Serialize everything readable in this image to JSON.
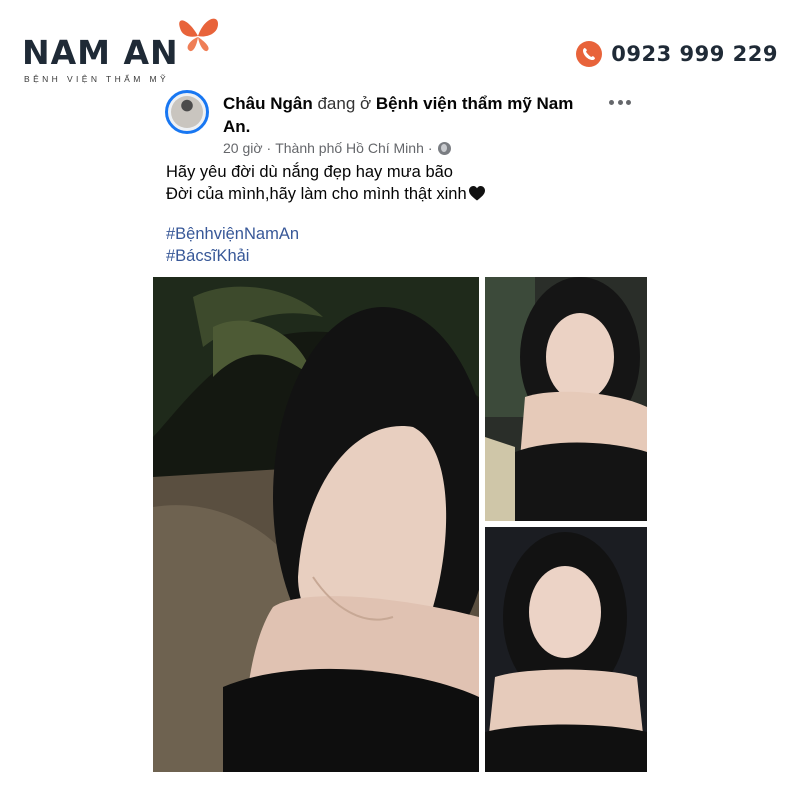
{
  "brand": {
    "name": "NAM AN",
    "subtitle": "BỆNH VIỆN THẨM MỸ",
    "accent_color": "#e8633a",
    "phone": "0923 999 229",
    "phone_icon": "phone-icon",
    "logo_icon": "butterfly-icon"
  },
  "post": {
    "author": "Châu Ngân",
    "checkin_text": "đang ở",
    "location": "Bệnh viện thẩm mỹ Nam An.",
    "time": "20 giờ",
    "separator": "·",
    "place": "Thành phố Hồ Chí Minh",
    "separator2": "·",
    "privacy_icon": "globe-icon",
    "more_icon": "more-options-icon",
    "text_lines": [
      "Hãy yêu đời dù nắng đẹp hay mưa bão",
      "Đời của mình,hãy làm cho mình thật xinh"
    ],
    "emoji": "black-heart",
    "hashtags": [
      "#BệnhviệnNamAn",
      "#BácsĩKhải"
    ],
    "link_color": "#385898"
  }
}
